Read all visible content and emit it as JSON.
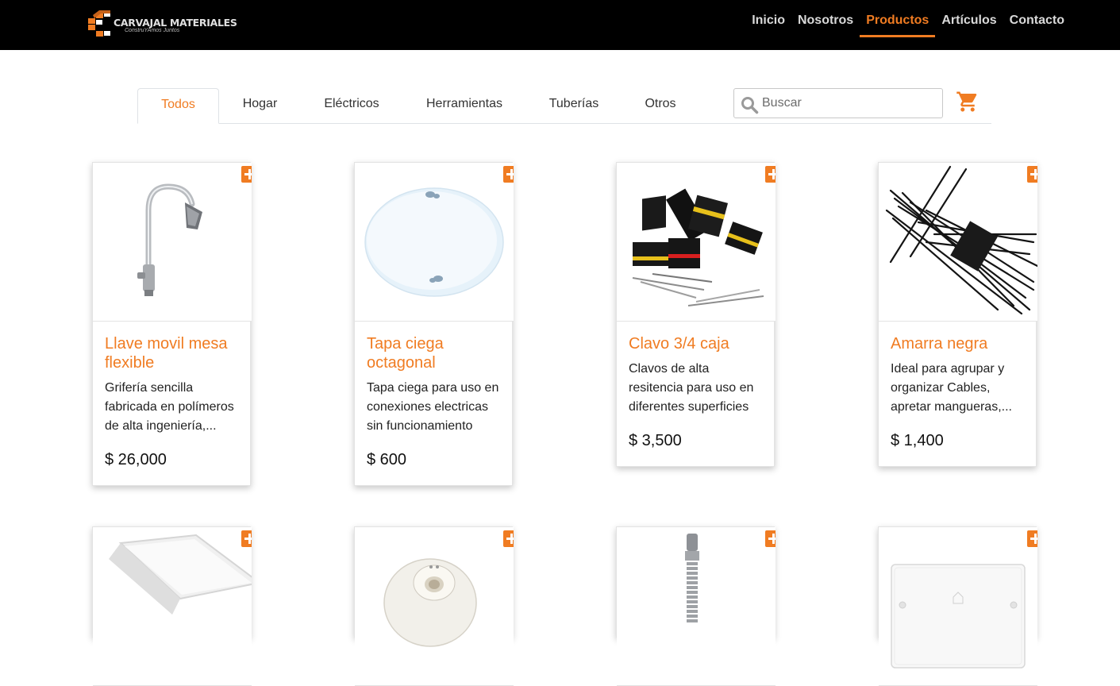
{
  "brand": {
    "name": "CARVAJAL MATERIALES",
    "tagline": "ConstruYAmos Juntos",
    "accent": "#f07c22"
  },
  "nav": {
    "items": [
      {
        "label": "Inicio"
      },
      {
        "label": "Nosotros"
      },
      {
        "label": "Productos",
        "active": true
      },
      {
        "label": "Artículos"
      },
      {
        "label": "Contacto"
      }
    ]
  },
  "tabs": [
    {
      "label": "Todos",
      "active": true
    },
    {
      "label": "Hogar"
    },
    {
      "label": "Eléctricos"
    },
    {
      "label": "Herramientas"
    },
    {
      "label": "Tuberías"
    },
    {
      "label": "Otros"
    }
  ],
  "search": {
    "placeholder": "Buscar",
    "value": ""
  },
  "icons": {
    "search": "search-icon",
    "cart": "cart-icon",
    "add": "plus-icon"
  },
  "products": [
    {
      "title": "Llave movil mesa flexible",
      "desc": "Grifería sencilla fabricada en polímeros de alta ingeniería,...",
      "price": "$ 26,000",
      "image": "faucet"
    },
    {
      "title": "Tapa ciega octagonal",
      "desc": "Tapa ciega para uso en conexiones electricas sin funcionamiento",
      "price": "$ 600",
      "image": "octagonal-cover"
    },
    {
      "title": "Clavo 3/4 caja",
      "desc": "Clavos de alta resitencia para uso en diferentes superficies",
      "price": "$ 3,500",
      "image": "nails-boxes"
    },
    {
      "title": "Amarra negra",
      "desc": "Ideal para agrupar y organizar Cables, apretar mangueras,...",
      "price": "$ 1,400",
      "image": "black-cable-ties"
    },
    {
      "image": "square-panel-light"
    },
    {
      "image": "lamp-socket"
    },
    {
      "image": "flexible-hose"
    },
    {
      "image": "blank-wall-plate"
    }
  ]
}
